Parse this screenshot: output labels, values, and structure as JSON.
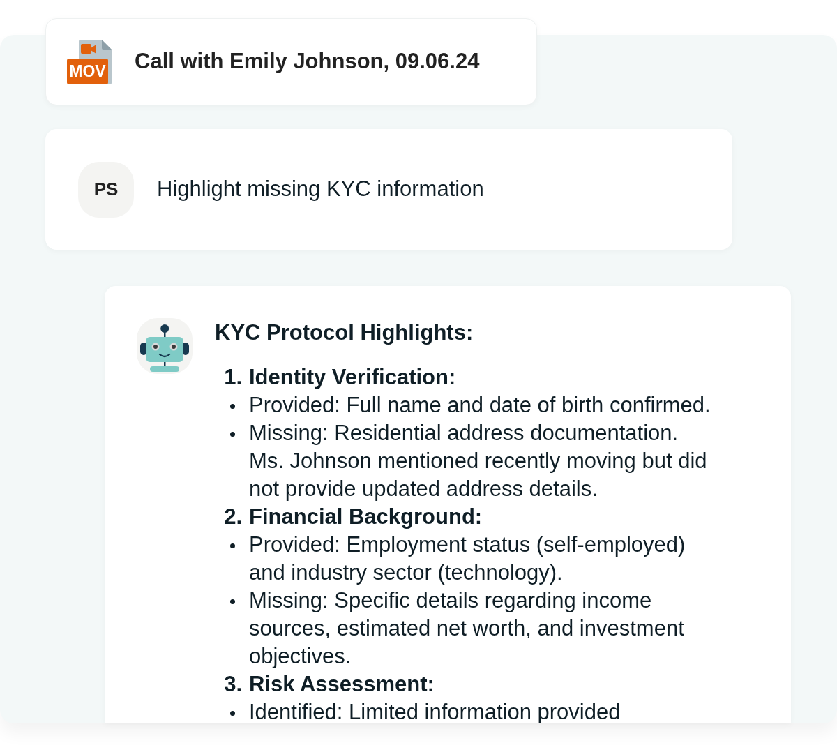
{
  "file_card": {
    "file_type": "MOV",
    "title": "Call with Emily Johnson, 09.06.24"
  },
  "user_message": {
    "initials": "PS",
    "text": "Highlight missing KYC information"
  },
  "assistant_message": {
    "heading": "KYC Protocol Highlights:",
    "sections": [
      {
        "number": "1.",
        "title": "Identity Verification:",
        "items": [
          "Provided: Full name and date of birth confirmed.",
          "Missing: Residential address documentation. Ms. Johnson mentioned recently moving but did not provide updated address details."
        ]
      },
      {
        "number": "2.",
        "title": "Financial Background:",
        "items": [
          "Provided: Employment status (self-employed) and industry sector (technology).",
          "Missing: Specific details regarding income sources, estimated net worth, and investment objectives."
        ]
      },
      {
        "number": "3.",
        "title": "Risk Assessment:",
        "items": [
          "Identified: Limited information provided"
        ]
      }
    ]
  }
}
